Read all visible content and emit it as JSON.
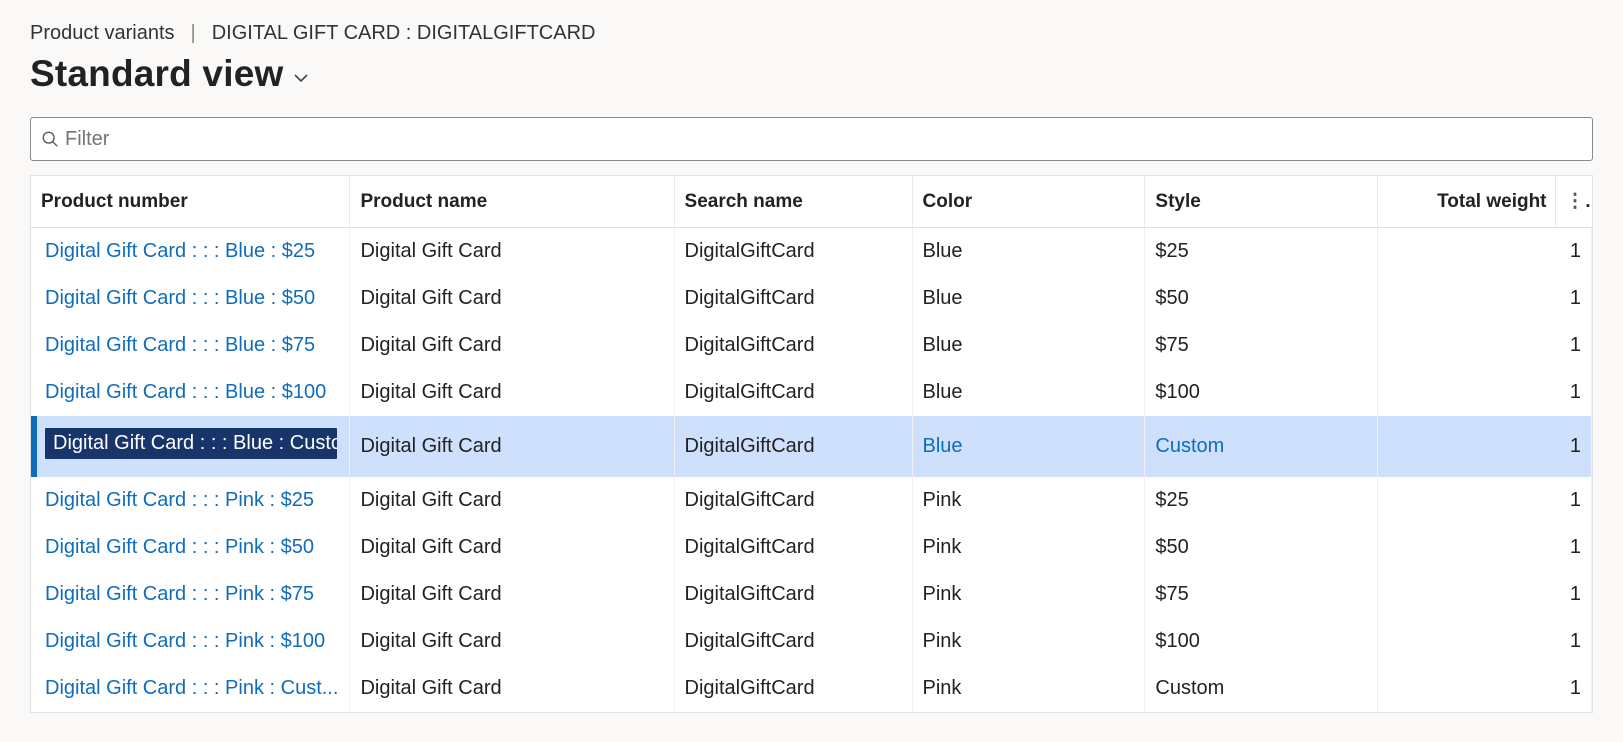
{
  "breadcrumb": {
    "section": "Product variants",
    "detail": "DIGITAL GIFT CARD : DIGITALGIFTCARD"
  },
  "view": {
    "title": "Standard view"
  },
  "filter": {
    "placeholder": "Filter",
    "value": ""
  },
  "columns": {
    "product_number": "Product number",
    "product_name": "Product name",
    "search_name": "Search name",
    "color": "Color",
    "style": "Style",
    "total_weight": "Total weight"
  },
  "selected_index": 4,
  "rows": [
    {
      "product_number": "Digital Gift Card :  :  : Blue : $25",
      "product_name": "Digital Gift Card",
      "search_name": "DigitalGiftCard",
      "color": "Blue",
      "style": "$25",
      "total_weight": "1"
    },
    {
      "product_number": "Digital Gift Card :  :  : Blue : $50",
      "product_name": "Digital Gift Card",
      "search_name": "DigitalGiftCard",
      "color": "Blue",
      "style": "$50",
      "total_weight": "1"
    },
    {
      "product_number": "Digital Gift Card :  :  : Blue : $75",
      "product_name": "Digital Gift Card",
      "search_name": "DigitalGiftCard",
      "color": "Blue",
      "style": "$75",
      "total_weight": "1"
    },
    {
      "product_number": "Digital Gift Card :  :  : Blue : $100",
      "product_name": "Digital Gift Card",
      "search_name": "DigitalGiftCard",
      "color": "Blue",
      "style": "$100",
      "total_weight": "1"
    },
    {
      "product_number": "Digital Gift Card :  :  : Blue : Custom",
      "product_name": "Digital Gift Card",
      "search_name": "DigitalGiftCard",
      "color": "Blue",
      "style": "Custom",
      "total_weight": "1"
    },
    {
      "product_number": "Digital Gift Card :  :  : Pink : $25",
      "product_name": "Digital Gift Card",
      "search_name": "DigitalGiftCard",
      "color": "Pink",
      "style": "$25",
      "total_weight": "1"
    },
    {
      "product_number": "Digital Gift Card :  :  : Pink : $50",
      "product_name": "Digital Gift Card",
      "search_name": "DigitalGiftCard",
      "color": "Pink",
      "style": "$50",
      "total_weight": "1"
    },
    {
      "product_number": "Digital Gift Card :  :  : Pink : $75",
      "product_name": "Digital Gift Card",
      "search_name": "DigitalGiftCard",
      "color": "Pink",
      "style": "$75",
      "total_weight": "1"
    },
    {
      "product_number": "Digital Gift Card :  :  : Pink : $100",
      "product_name": "Digital Gift Card",
      "search_name": "DigitalGiftCard",
      "color": "Pink",
      "style": "$100",
      "total_weight": "1"
    },
    {
      "product_number": "Digital Gift Card :  :  : Pink : Cust...",
      "product_name": "Digital Gift Card",
      "search_name": "DigitalGiftCard",
      "color": "Pink",
      "style": "Custom",
      "total_weight": "1"
    }
  ]
}
